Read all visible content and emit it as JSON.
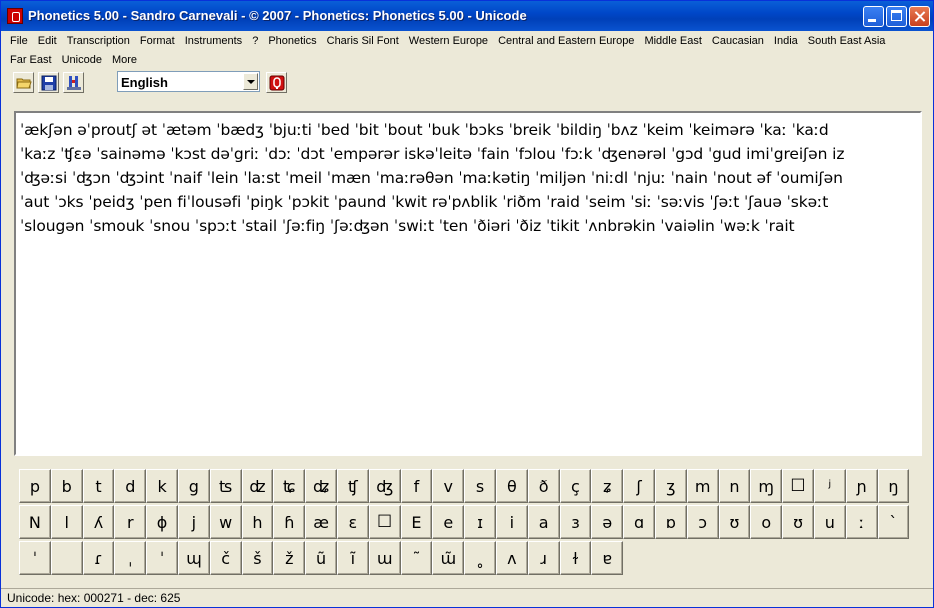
{
  "window": {
    "title": "Phonetics 5.00 - Sandro Carnevali - ©  2007 - Phonetics: Phonetics 5.00 - Unicode"
  },
  "menu": {
    "row1": [
      "File",
      "Edit",
      "Transcription",
      "Format",
      "Instruments",
      "?",
      "Phonetics",
      "Charis Sil Font",
      "Western Europe",
      "Central and Eastern Europe",
      "Middle East",
      "Caucasian",
      "India",
      "South East Asia"
    ],
    "row2": [
      "Far East",
      "Unicode",
      "More"
    ]
  },
  "toolbar": {
    "language": "English",
    "icons": [
      "open-folder-icon",
      "save-disk-icon",
      "tools-icon",
      "record-icon"
    ]
  },
  "editor": {
    "lines": [
      "ˈækʃən əˈproutʃ ət ˈætəm ˈbædʒ ˈbjuːti ˈbed ˈbit ˈbout ˈbuk ˈbɔks ˈbreik ˈbildiŋ ˈbʌz ˈkeim ˈkeimərə ˈkaː ˈkaːd",
      "ˈkaːz ˈʧɛə ˈsainəmə ˈkɔst dəˈgriː ˈdɔː ˈdɔt ˈempərər iskəˈleitə ˈfain ˈfɔlou ˈfɔːk ˈʤenərəl ˈgɔd ˈgud imiˈgreiʃən iz",
      "ˈʤəːsi ˈʤɔn ˈʤɔint ˈnaif ˈlein ˈlaːst ˈmeil ˈmæn ˈmaːrəθən ˈmaːkətiŋ ˈmiljən ˈniːdl ˈnjuː ˈnain ˈnout əf ˈoumiʃən",
      "ˈaut ˈɔks ˈpeidʒ ˈpen fiˈlousəfi ˈpiŋk ˈpɔkit ˈpaund ˈkwit rəˈpʌblik ˈriðm ˈraid ˈseim ˈsiː ˈsəːvis ˈʃəːt ˈʃauə ˈskəːt",
      "ˈslougən ˈsmouk ˈsnou ˈspɔːt ˈstail ˈʃəːfiŋ ˈʃəːʤən ˈswiːt ˈten ˈðiəri ˈðiz ˈtikit ˈʌnbrəkin ˈvaiəlin ˈwəːk ˈrait"
    ]
  },
  "keyboard": {
    "rows": [
      [
        "p",
        "b",
        "t",
        "d",
        "k",
        "g",
        "ʦ",
        "ʣ",
        "ʨ",
        "ʥ",
        "ʧ",
        "ʤ",
        "f",
        "v",
        "s",
        "θ",
        "ð",
        "ç",
        "ʑ",
        "ʃ",
        "ʒ",
        "m",
        "n",
        "ɱ",
        "☐",
        "ʲ",
        "ɲ",
        "ŋ"
      ],
      [
        "N",
        "l",
        "ʎ",
        "r",
        "ɸ",
        "j",
        "w",
        "h",
        "ɦ",
        "æ",
        "ɛ",
        "☐",
        "E",
        "e",
        "ɪ",
        "i",
        "a",
        "ɜ",
        "ə",
        "ɑ",
        "ɒ",
        "ɔ",
        "ʊ",
        "o",
        "ʊ",
        "u",
        "ː",
        "ˋ"
      ],
      [
        "ˈ",
        " ",
        "ɾ",
        "ˌ",
        "ˈ",
        "ɰ",
        "č",
        "š",
        "ž",
        "ũ",
        "ĩ",
        "ɯ",
        "˜",
        "ɯ̃",
        "˳",
        "ʌ",
        "ɹ",
        "ɫ",
        "ɐ"
      ]
    ]
  },
  "status": {
    "text": "Unicode: hex: 000271 - dec: 625"
  }
}
